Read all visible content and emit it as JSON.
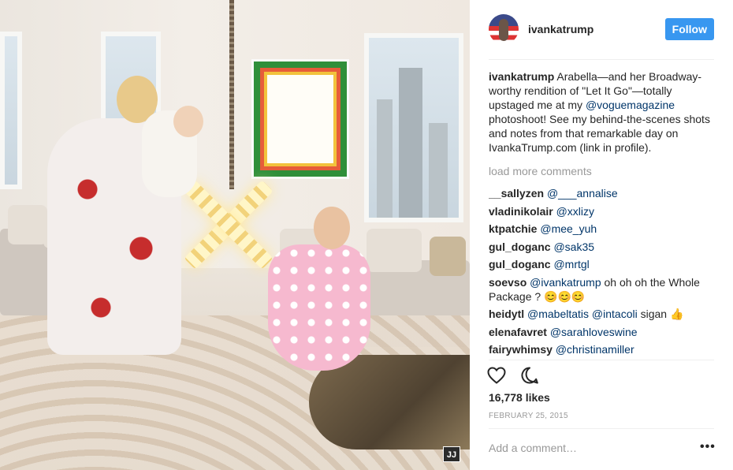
{
  "post": {
    "username": "ivankatrump",
    "follow_label": "Follow",
    "caption": {
      "author": "ivankatrump",
      "text_1": " Arabella—and her Broadway-worthy rendition of \"Let It Go\"—totally upstaged me at my ",
      "mention": "@voguemagazine",
      "text_2": " photoshoot! See my behind-the-scenes shots and notes from that remarkable day on IvankaTrump.com (link in profile)."
    },
    "load_more": "load more comments",
    "comments": [
      {
        "user": "__sallyzen",
        "text": "@___annalise",
        "is_mention": true
      },
      {
        "user": "vladinikolair",
        "text": "@xxlizy",
        "is_mention": true
      },
      {
        "user": "ktpatchie",
        "text": "@mee_yuh",
        "is_mention": true
      },
      {
        "user": "gul_doganc",
        "text": "@sak35",
        "is_mention": true
      },
      {
        "user": "gul_doganc",
        "text": "@mrtgl",
        "is_mention": true
      },
      {
        "user": "soevso",
        "mention": "@ivankatrump",
        "text": " oh oh oh the Whole Package ? 😊😊😊"
      },
      {
        "user": "heidytl",
        "mention": "@mabeltatis @intacoli",
        "text": " sigan 👍"
      },
      {
        "user": "elenafavret",
        "text": "@sarahloveswine",
        "is_mention": true
      },
      {
        "user": "fairywhimsy",
        "text": "@christinamiller",
        "is_mention": true
      }
    ],
    "likes": "16,778 likes",
    "date": "FEBRUARY 25, 2015",
    "add_comment_placeholder": "Add a comment…",
    "more_label": "•••",
    "watermark": "JJ"
  },
  "icons": {
    "like": "heart-icon",
    "comment": "comment-icon",
    "more": "more-options-icon"
  },
  "colors": {
    "follow_button": "#3897f0",
    "link": "#003569",
    "muted": "#999999",
    "text": "#262626"
  }
}
